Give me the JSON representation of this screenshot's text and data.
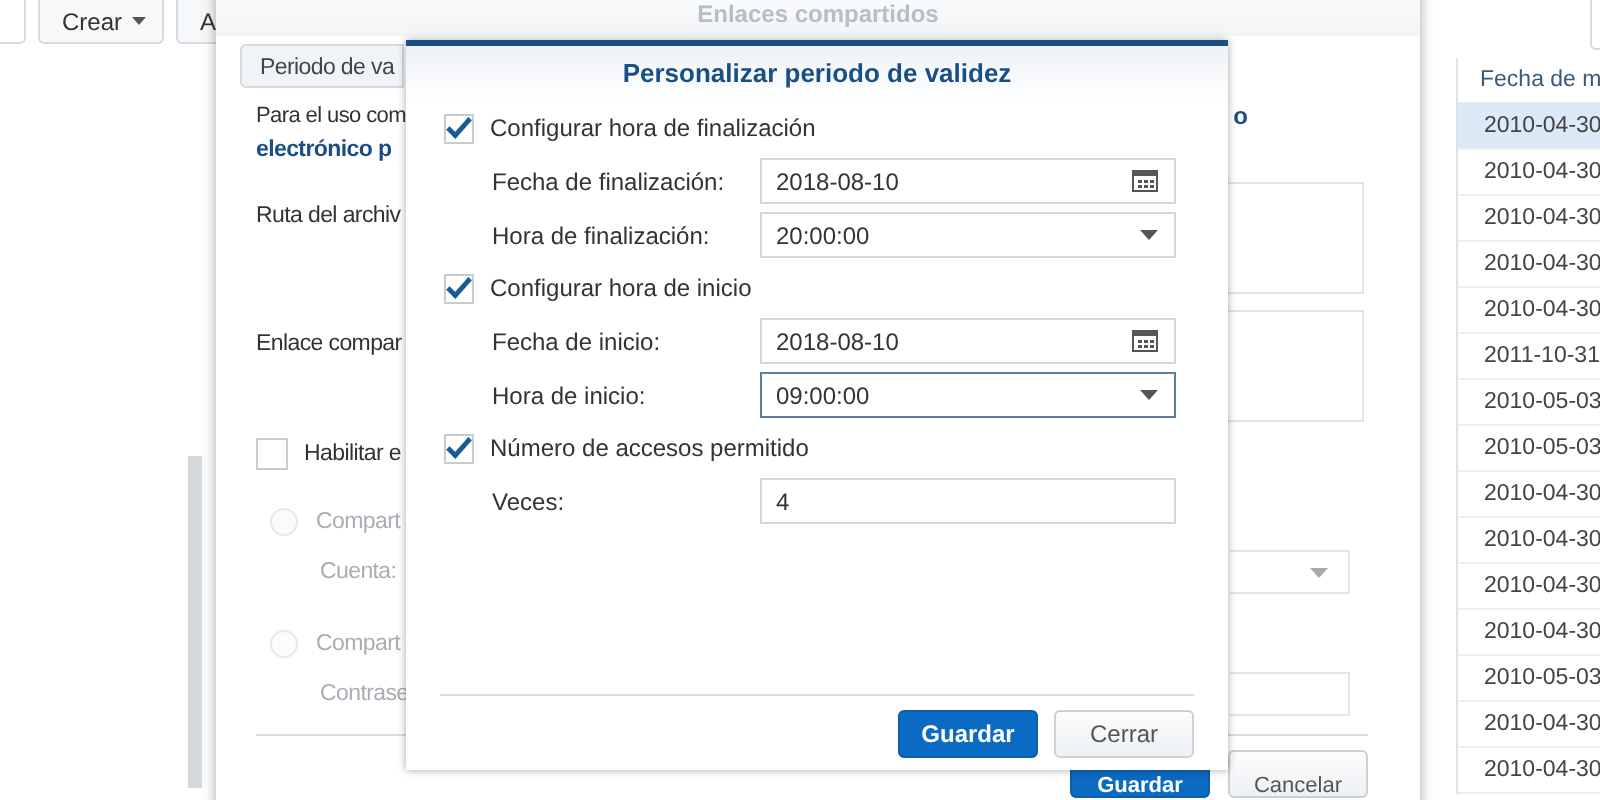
{
  "toolbar": {
    "buttons": [
      {
        "label": "Crear",
        "kind": "dropdown"
      },
      {
        "label": "A",
        "kind": "plain"
      }
    ]
  },
  "file_table": {
    "columns": [
      "Fecha de m"
    ],
    "rows": [
      {
        "cells": [
          "2010-04-30"
        ],
        "selected": true
      },
      {
        "cells": [
          "2010-04-30"
        ],
        "selected": false
      },
      {
        "cells": [
          "2010-04-30"
        ],
        "selected": false
      },
      {
        "cells": [
          "2010-04-30"
        ],
        "selected": false
      },
      {
        "cells": [
          "2010-04-30"
        ],
        "selected": false
      },
      {
        "cells": [
          "2011-10-31"
        ],
        "selected": false
      },
      {
        "cells": [
          "2010-05-03"
        ],
        "selected": false
      },
      {
        "cells": [
          "2010-05-03"
        ],
        "selected": false
      },
      {
        "cells": [
          "2010-04-30"
        ],
        "selected": false
      },
      {
        "cells": [
          "2010-04-30"
        ],
        "selected": false
      },
      {
        "cells": [
          "2010-04-30"
        ],
        "selected": false
      },
      {
        "cells": [
          "2010-04-30"
        ],
        "selected": false
      },
      {
        "cells": [
          "2010-05-03"
        ],
        "selected": false
      },
      {
        "cells": [
          "2010-04-30"
        ],
        "selected": false
      },
      {
        "cells": [
          "2010-04-30"
        ],
        "selected": false
      }
    ]
  },
  "share_dialog": {
    "title": "Enlaces compartidos",
    "tabs": [
      {
        "label": "Periodo de va",
        "selected": true
      }
    ],
    "intro": "Para el uso com",
    "intro_tail": "o",
    "intro_link": "electrónico p",
    "fields": [
      {
        "label": "Ruta del archiv"
      },
      {
        "label": "Enlace compar"
      }
    ],
    "enable_checkbox": {
      "label": "Habilitar e",
      "checked": false
    },
    "options": [
      {
        "label": "Compart",
        "selected": false,
        "disabled": true,
        "field": {
          "label": "Cuenta:",
          "kind": "dropdown"
        }
      },
      {
        "label": "Compart",
        "selected": false,
        "disabled": true,
        "field": {
          "label": "Contrase",
          "kind": "text"
        }
      }
    ],
    "buttons": [
      {
        "label": "Guardar",
        "kind": "primary"
      },
      {
        "label": "Cancelar",
        "kind": "secondary"
      }
    ]
  },
  "validity_dialog": {
    "title": "Personalizar periodo de validez",
    "sections": [
      {
        "label": "Configurar hora de finalización",
        "checked": true,
        "fields": [
          {
            "label": "Fecha de finalización:",
            "value": "2018-08-10",
            "kind": "date",
            "focused": false
          },
          {
            "label": "Hora de finalización:",
            "value": "20:00:00",
            "kind": "select",
            "focused": false
          }
        ]
      },
      {
        "label": "Configurar hora de inicio",
        "checked": true,
        "fields": [
          {
            "label": "Fecha de inicio:",
            "value": "2018-08-10",
            "kind": "date",
            "focused": false
          },
          {
            "label": "Hora de inicio:",
            "value": "09:00:00",
            "kind": "select",
            "focused": true
          }
        ]
      },
      {
        "label": "Número de accesos permitido",
        "checked": true,
        "fields": [
          {
            "label": "Veces:",
            "value": "4",
            "kind": "text",
            "focused": false
          }
        ]
      }
    ],
    "buttons": [
      {
        "label": "Guardar",
        "kind": "primary"
      },
      {
        "label": "Cerrar",
        "kind": "secondary"
      }
    ]
  }
}
